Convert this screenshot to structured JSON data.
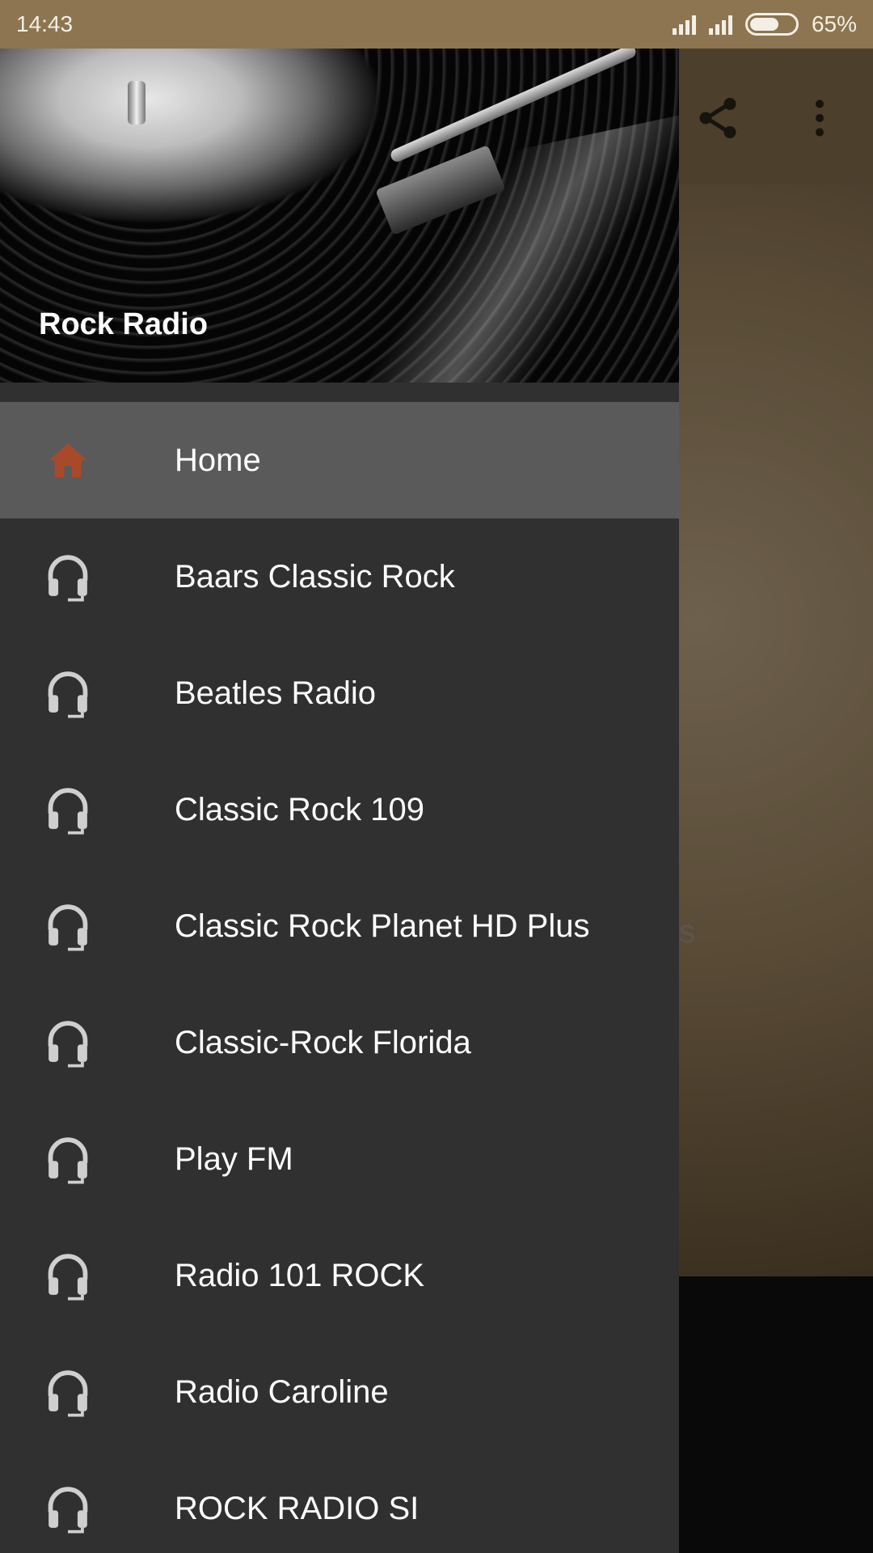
{
  "status_bar": {
    "time": "14:43",
    "battery_percent": "65%",
    "battery_level": 0.65
  },
  "app": {
    "peek_text": "s",
    "toolbar_icons": [
      "share-icon",
      "more-vert-icon"
    ]
  },
  "drawer": {
    "title": "Rock Radio",
    "items": [
      {
        "label": "Home",
        "icon": "home-icon",
        "active": true
      },
      {
        "label": "Baars Classic Rock",
        "icon": "headphones-icon"
      },
      {
        "label": "Beatles Radio",
        "icon": "headphones-icon"
      },
      {
        "label": "Classic Rock 109",
        "icon": "headphones-icon"
      },
      {
        "label": "Classic Rock Planet HD Plus",
        "icon": "headphones-icon"
      },
      {
        "label": "Classic-Rock Florida",
        "icon": "headphones-icon"
      },
      {
        "label": "Play FM",
        "icon": "headphones-icon"
      },
      {
        "label": "Radio 101 ROCK",
        "icon": "headphones-icon"
      },
      {
        "label": "Radio Caroline",
        "icon": "headphones-icon"
      },
      {
        "label": "ROCK RADIO SI",
        "icon": "headphones-icon"
      }
    ]
  },
  "colors": {
    "status_bar": "#8c7550",
    "drawer_bg": "#303030",
    "active_item_bg": "#5a5a5a",
    "home_icon": "#a84a2a",
    "headphones_icon": "#cfcfcf"
  }
}
